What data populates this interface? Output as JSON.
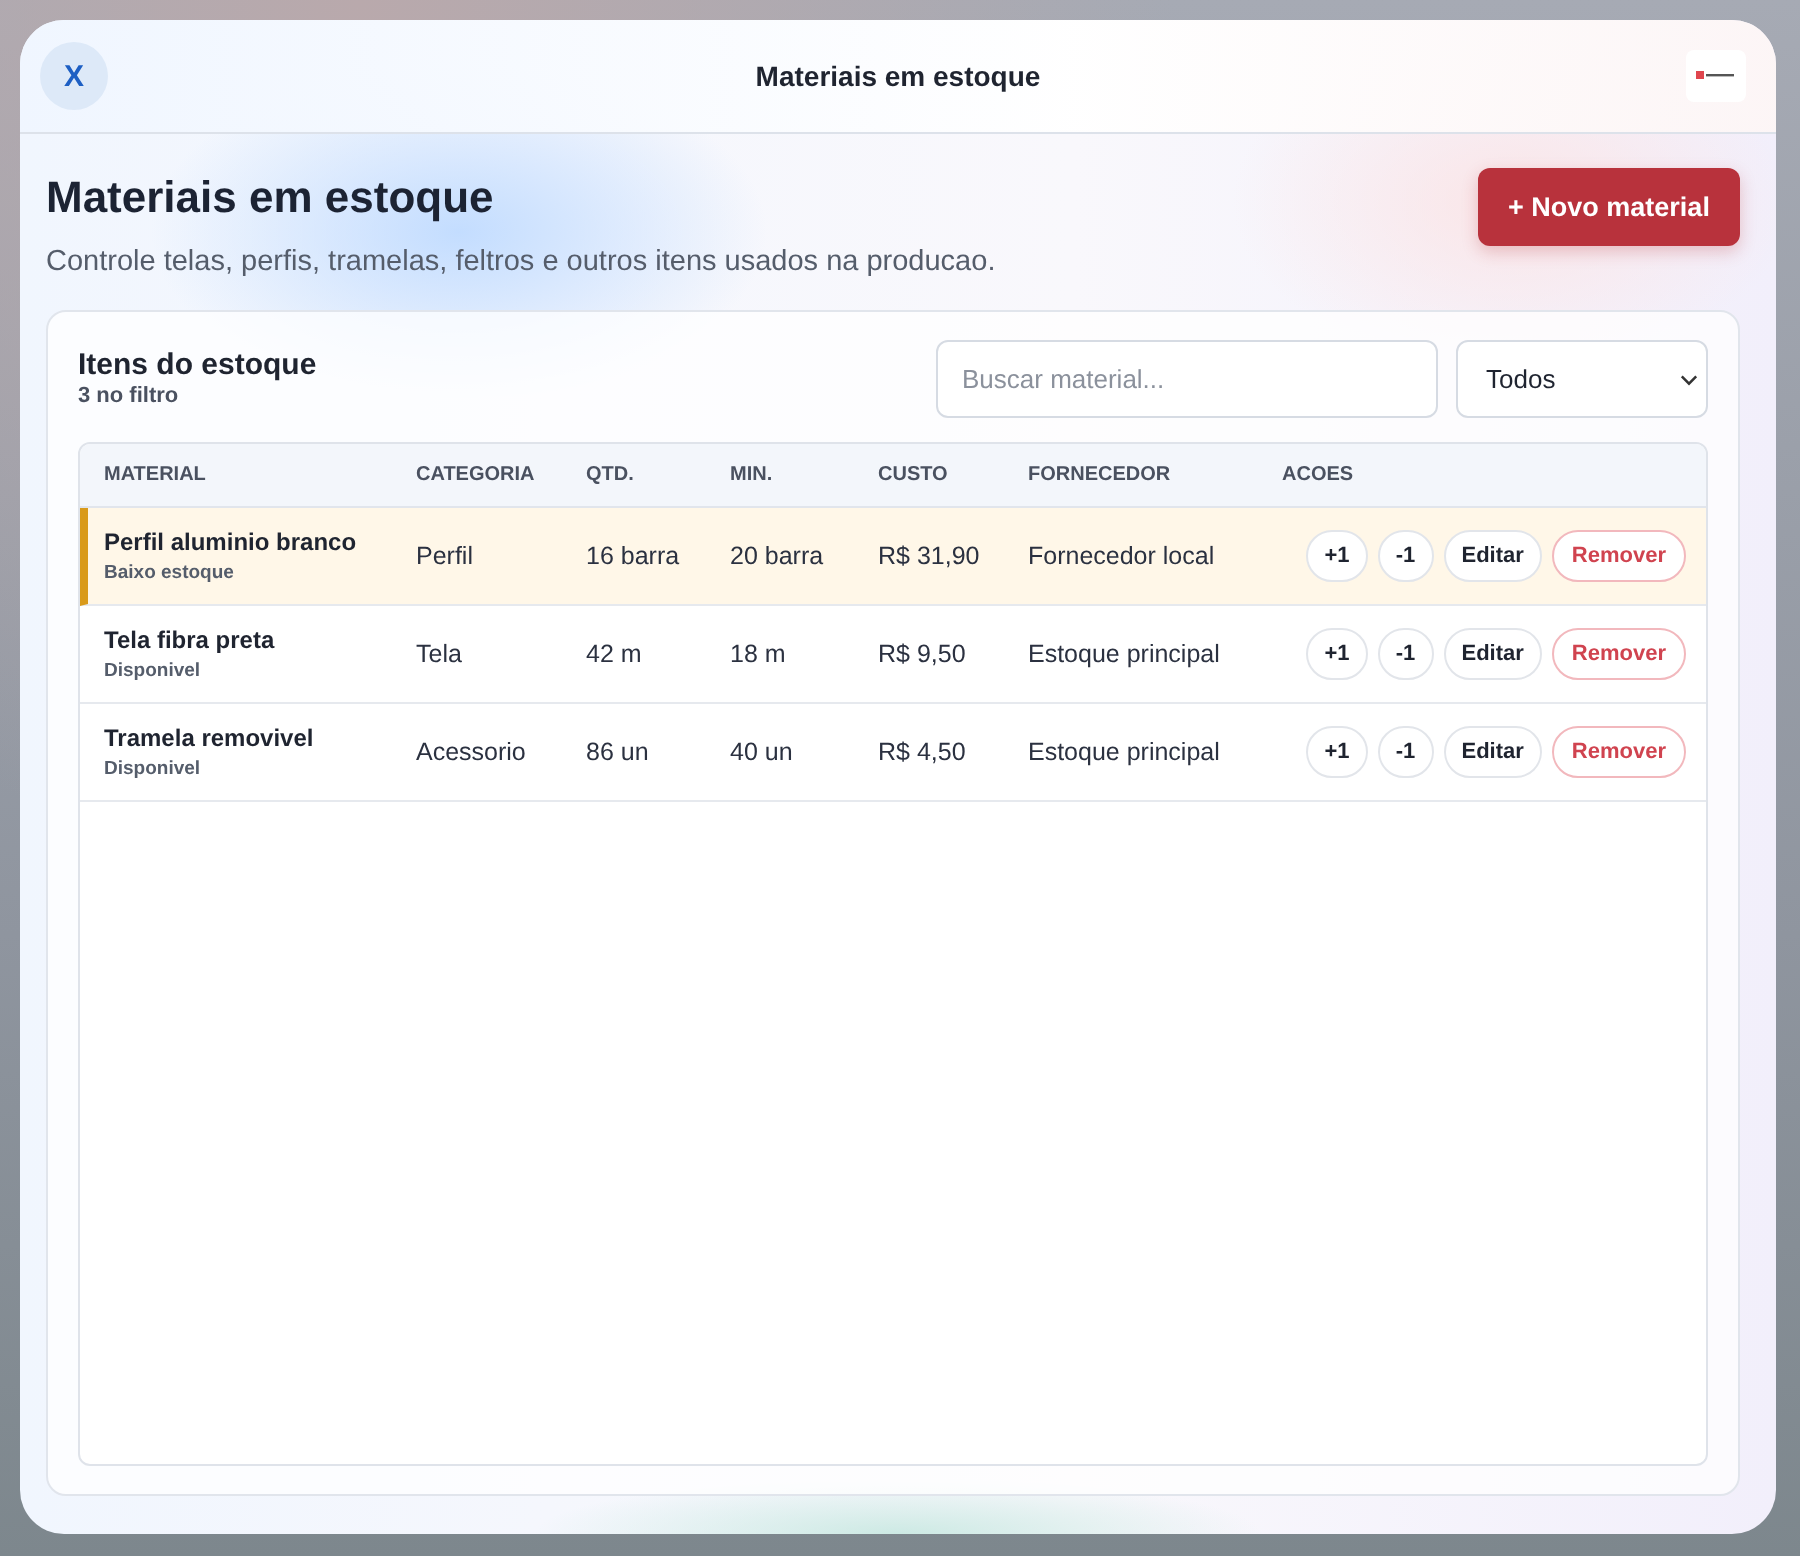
{
  "window": {
    "title": "Materiais em estoque",
    "close_label": "X"
  },
  "page": {
    "heading": "Materiais em estoque",
    "subtitle": "Controle telas, perfis, tramelas, feltros e outros itens usados na producao.",
    "new_button": "+ Novo material"
  },
  "panel": {
    "title": "Itens do estoque",
    "count": "3 no filtro",
    "search": {
      "placeholder": "Buscar material..."
    },
    "filter": {
      "value": "Todos"
    }
  },
  "table": {
    "columns": [
      "MATERIAL",
      "CATEGORIA",
      "QTD.",
      "MIN.",
      "CUSTO",
      "FORNECEDOR",
      "ACOES"
    ],
    "rows": [
      {
        "material": "Perfil aluminio branco",
        "status": "Baixo estoque",
        "low_stock": true,
        "category": "Perfil",
        "quantity": "16 barra",
        "minimum": "20 barra",
        "cost": "R$ 31,90",
        "supplier": "Fornecedor local",
        "actions": [
          {
            "label": "+1",
            "kind": "neutral"
          },
          {
            "label": "-1",
            "kind": "neutral"
          },
          {
            "label": "Editar",
            "kind": "neutral"
          },
          {
            "label": "Remover",
            "kind": "danger"
          }
        ]
      },
      {
        "material": "Tela fibra preta",
        "status": "Disponivel",
        "low_stock": false,
        "category": "Tela",
        "quantity": "42 m",
        "minimum": "18 m",
        "cost": "R$ 9,50",
        "supplier": "Estoque principal",
        "actions": [
          {
            "label": "+1",
            "kind": "neutral"
          },
          {
            "label": "-1",
            "kind": "neutral"
          },
          {
            "label": "Editar",
            "kind": "neutral"
          },
          {
            "label": "Remover",
            "kind": "danger"
          }
        ]
      },
      {
        "material": "Tramela removivel",
        "status": "Disponivel",
        "low_stock": false,
        "category": "Acessorio",
        "quantity": "86 un",
        "minimum": "40 un",
        "cost": "R$ 4,50",
        "supplier": "Estoque principal",
        "actions": [
          {
            "label": "+1",
            "kind": "neutral"
          },
          {
            "label": "-1",
            "kind": "neutral"
          },
          {
            "label": "Editar",
            "kind": "neutral"
          },
          {
            "label": "Remover",
            "kind": "danger"
          }
        ]
      }
    ]
  }
}
